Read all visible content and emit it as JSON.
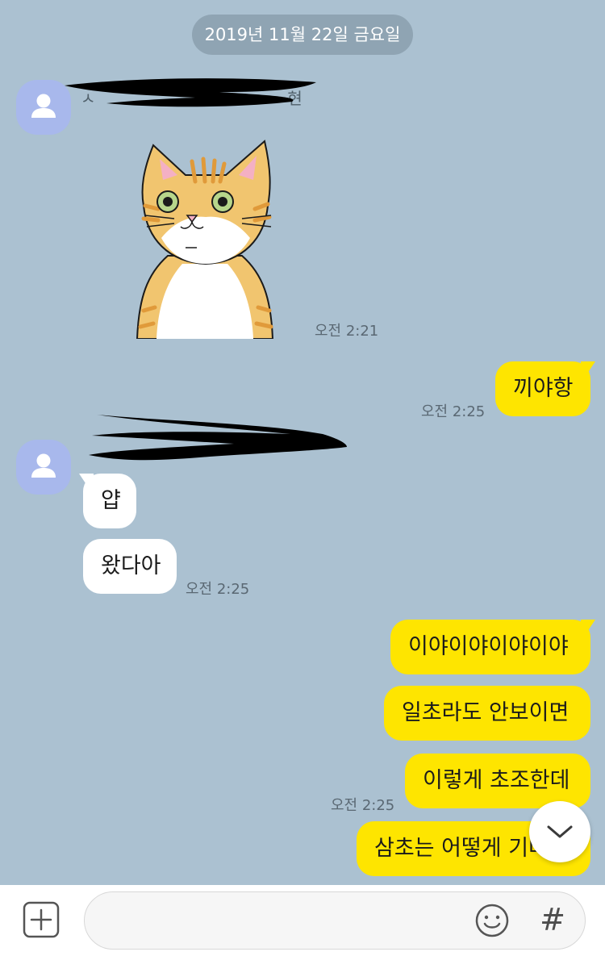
{
  "date_divider": "2019년 11월 22일 금요일",
  "messages": [
    {
      "type": "sticker",
      "side": "in",
      "icon": "orange-tabby-cat-sticker",
      "time": "오전 2:21"
    },
    {
      "side": "out",
      "text": "끼야항",
      "time": "오전 2:25"
    },
    {
      "side": "in",
      "text": "얍"
    },
    {
      "side": "in",
      "text": "왔다아",
      "time": "오전 2:25"
    },
    {
      "side": "out",
      "text": "이야이야이야이야"
    },
    {
      "side": "out",
      "text": "일초라도 안보이면"
    },
    {
      "side": "out",
      "text": "이렇게 초조한데",
      "time": "오전 2:25"
    },
    {
      "side": "out",
      "text": "삼초는 어떻게 기다려"
    }
  ],
  "composer": {
    "placeholder": "",
    "plus_icon": "plus-square-icon",
    "emoji_icon": "smiley-icon",
    "hash_label": "#"
  },
  "colors": {
    "background": "#abc1d1",
    "outgoing_bubble": "#fee500",
    "incoming_bubble": "#ffffff",
    "avatar": "#a8b8ec"
  }
}
